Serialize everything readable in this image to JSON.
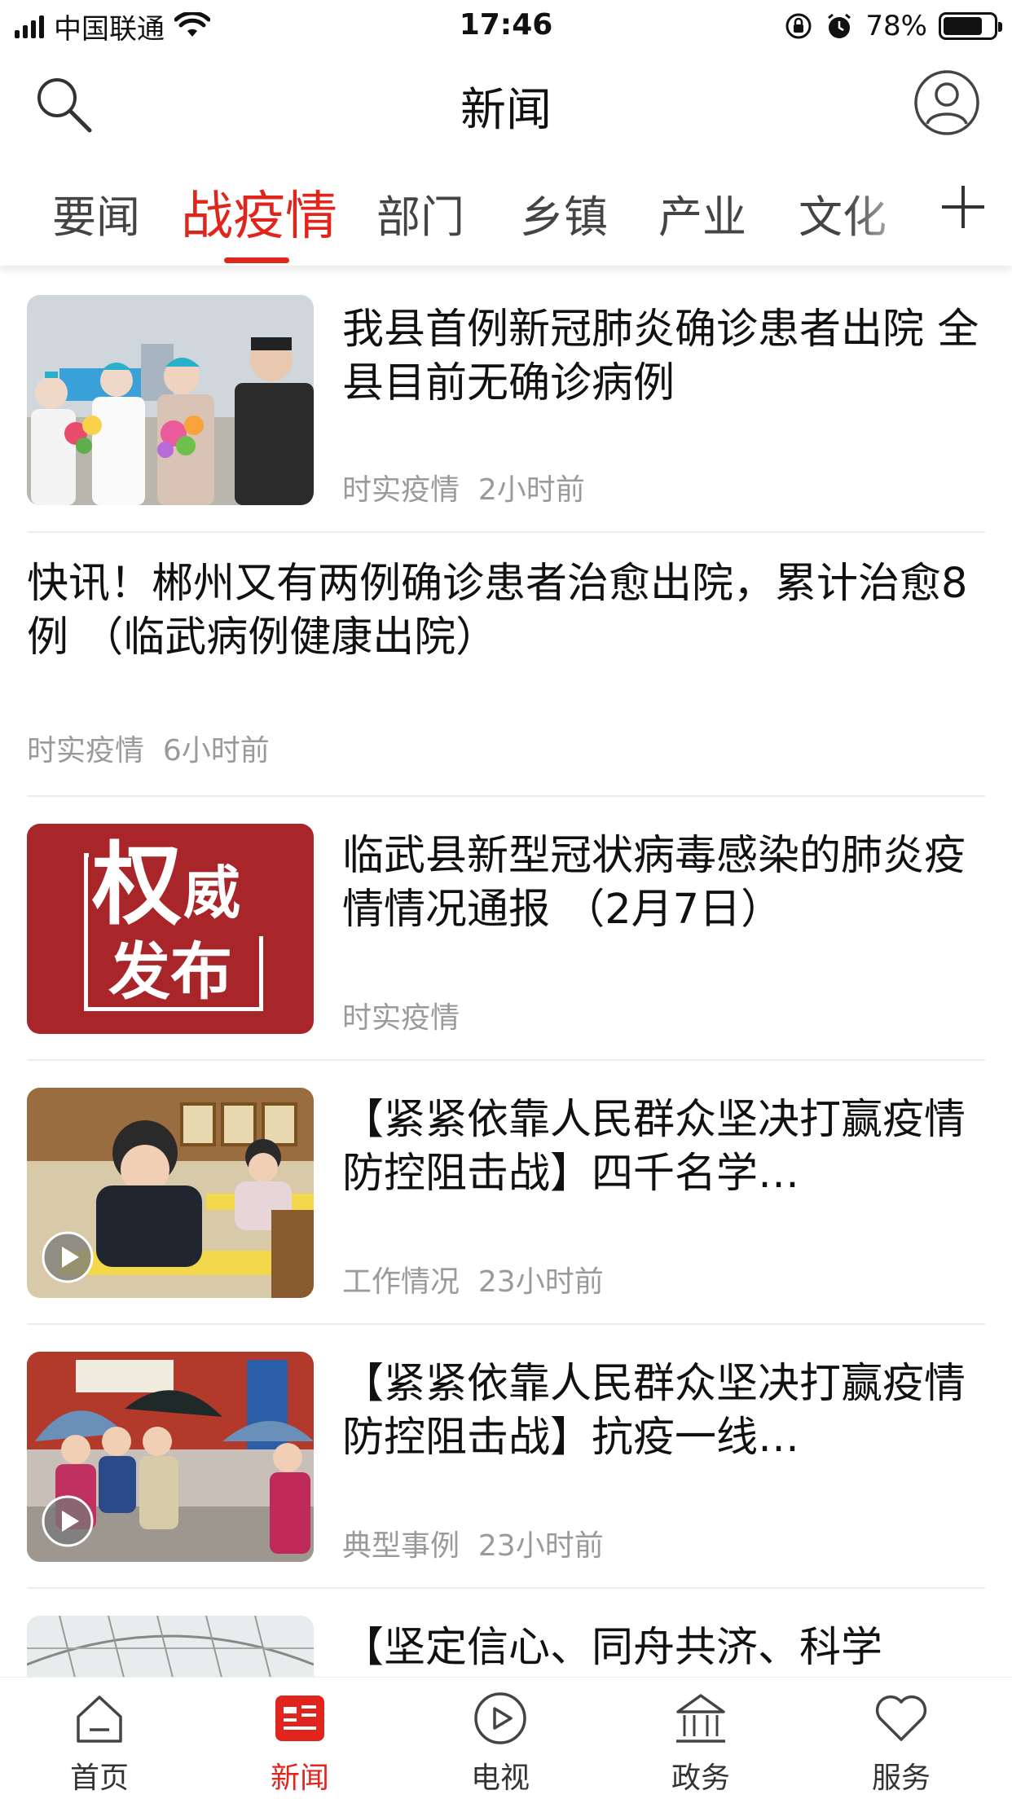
{
  "status_bar": {
    "carrier": "中国联通",
    "time": "17:46",
    "battery_percent": "78%",
    "battery_level": 0.78
  },
  "header": {
    "title": "新闻"
  },
  "tabs": [
    {
      "label": "要闻",
      "active": false
    },
    {
      "label": "战疫情",
      "active": true
    },
    {
      "label": "部门",
      "active": false
    },
    {
      "label": "乡镇",
      "active": false
    },
    {
      "label": "产业",
      "active": false
    },
    {
      "label": "文化",
      "active": false
    }
  ],
  "news": [
    {
      "title": "我县首例新冠肺炎确诊患者出院  全县目前无确诊病例",
      "category": "时实疫情",
      "time": "2小时前"
    },
    {
      "title": "快讯！郴州又有两例确诊患者治愈出院，累计治愈8例 （临武病例健康出院）",
      "category": "时实疫情",
      "time": "6小时前"
    },
    {
      "title": "临武县新型冠状病毒感染的肺炎疫情情况通报 （2月7日）",
      "category": "时实疫情",
      "time": "",
      "thumb_text_1": "权",
      "thumb_text_2": "威",
      "thumb_text_3": "发布"
    },
    {
      "title": "【紧紧依靠人民群众坚决打赢疫情防控阻击战】四千名学…",
      "category": "工作情况",
      "time": "23小时前"
    },
    {
      "title": "【紧紧依靠人民群众坚决打赢疫情防控阻击战】抗疫一线…",
      "category": "典型事例",
      "time": "23小时前"
    },
    {
      "title": "【坚定信心、同舟共济、科学"
    }
  ],
  "bottom_nav": [
    {
      "label": "首页",
      "icon": "home-icon",
      "active": false
    },
    {
      "label": "新闻",
      "icon": "news-icon",
      "active": true
    },
    {
      "label": "电视",
      "icon": "play-circle-icon",
      "active": false
    },
    {
      "label": "政务",
      "icon": "government-building-icon",
      "active": false
    },
    {
      "label": "服务",
      "icon": "heart-icon",
      "active": false
    }
  ],
  "colors": {
    "accent": "#e0261c",
    "meta_gray": "#9a9a9a",
    "divider": "#ececec"
  }
}
